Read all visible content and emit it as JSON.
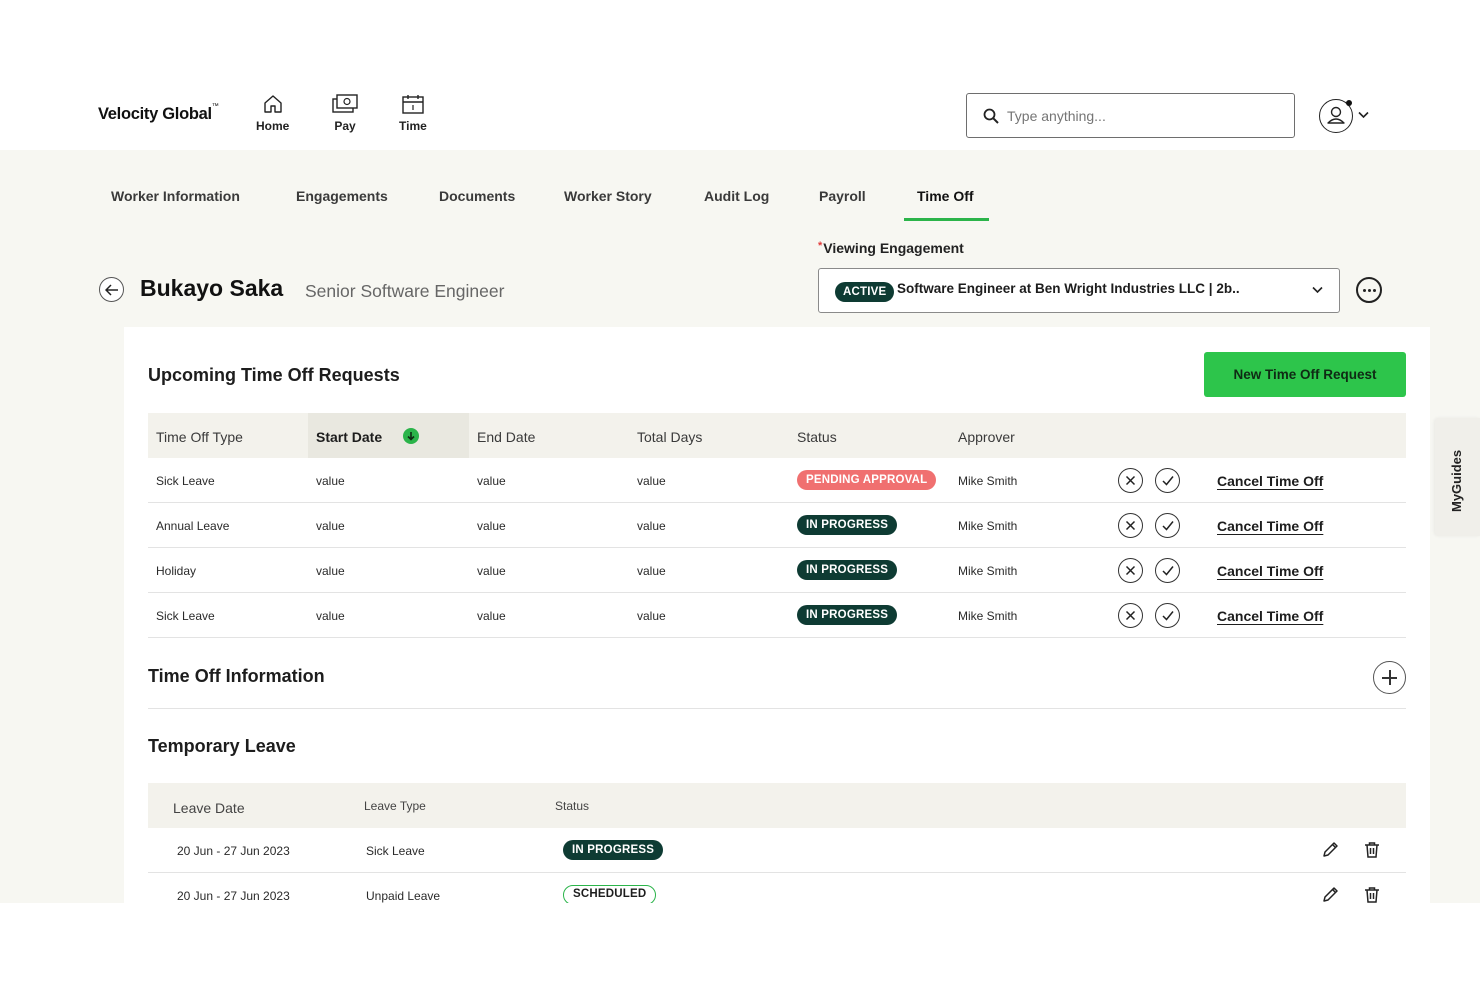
{
  "header": {
    "logo": "Velocity Global",
    "logo_mark": "™",
    "nav": [
      {
        "label": "Home",
        "icon": "home-icon"
      },
      {
        "label": "Pay",
        "icon": "pay-icon"
      },
      {
        "label": "Time",
        "icon": "calendar-icon"
      }
    ],
    "search": {
      "placeholder": "Type anything..."
    },
    "profile_icon": "user-avatar-icon"
  },
  "tabs": [
    {
      "label": "Worker Information",
      "active": false
    },
    {
      "label": "Engagements",
      "active": false
    },
    {
      "label": "Documents",
      "active": false
    },
    {
      "label": "Worker Story",
      "active": false
    },
    {
      "label": "Audit Log",
      "active": false
    },
    {
      "label": "Payroll",
      "active": false
    },
    {
      "label": "Time Off",
      "active": true
    }
  ],
  "engagement": {
    "required_mark": "*",
    "label": "Viewing Engagement",
    "status": "ACTIVE",
    "value": "Software Engineer at Ben Wright Industries LLC | 2b.."
  },
  "worker": {
    "name": "Bukayo Saka",
    "title": "Senior Software Engineer"
  },
  "upcoming": {
    "title": "Upcoming Time Off Requests",
    "new_button": "New Time Off Request",
    "columns": [
      "Time Off Type",
      "Start Date",
      "End Date",
      "Total Days",
      "Status",
      "Approver"
    ],
    "sorted_column": "Start Date",
    "rows": [
      {
        "type": "Sick Leave",
        "start": "value",
        "end": "value",
        "days": "value",
        "status": "PENDING APPROVAL",
        "status_kind": "pending",
        "approver": "Mike Smith",
        "action": "Cancel Time Off"
      },
      {
        "type": "Annual Leave",
        "start": "value",
        "end": "value",
        "days": "value",
        "status": "IN PROGRESS",
        "status_kind": "progress",
        "approver": "Mike Smith",
        "action": "Cancel Time Off"
      },
      {
        "type": "Holiday",
        "start": "value",
        "end": "value",
        "days": "value",
        "status": "IN PROGRESS",
        "status_kind": "progress",
        "approver": "Mike Smith",
        "action": "Cancel Time Off"
      },
      {
        "type": "Sick Leave",
        "start": "value",
        "end": "value",
        "days": "value",
        "status": "IN PROGRESS",
        "status_kind": "progress",
        "approver": "Mike Smith",
        "action": "Cancel Time Off"
      }
    ]
  },
  "info": {
    "title": "Time Off Information"
  },
  "temporary": {
    "title": "Temporary Leave",
    "columns": [
      "Leave Date",
      "Leave Type",
      "Status"
    ],
    "rows": [
      {
        "date": "20 Jun - 27 Jun 2023",
        "type": "Sick Leave",
        "status": "IN PROGRESS",
        "status_kind": "progress"
      },
      {
        "date": "20 Jun - 27 Jun 2023",
        "type": "Unpaid Leave",
        "status": "SCHEDULED",
        "status_kind": "scheduled"
      }
    ]
  },
  "side_tab": "MyGuides",
  "colors": {
    "accent_green": "#2dc54b",
    "dark_teal": "#0e3b33",
    "pending_red": "#f07070",
    "page_bg": "#f7f7f2"
  }
}
